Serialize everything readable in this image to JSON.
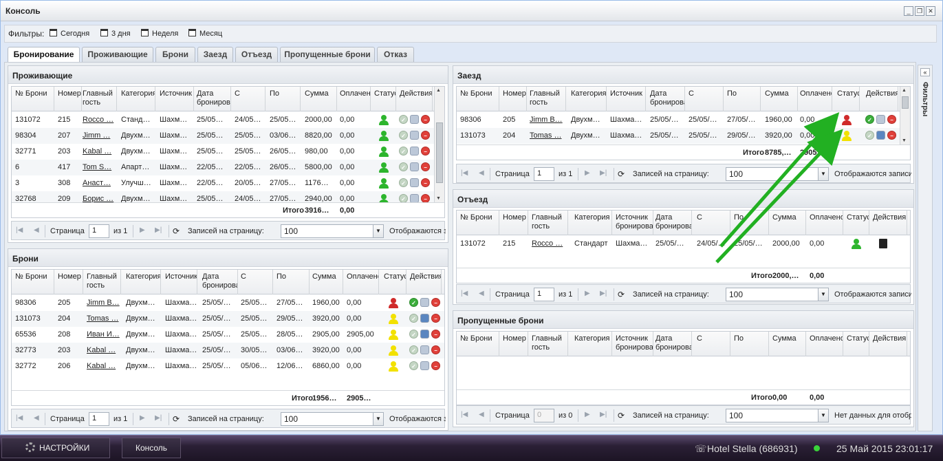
{
  "window": {
    "title": "Консоль"
  },
  "filters": {
    "label": "Фильтры:",
    "buttons": [
      "Сегодня",
      "3 дня",
      "Неделя",
      "Месяц"
    ]
  },
  "tabs": [
    "Бронирование",
    "Проживающие",
    "Брони",
    "Заезд",
    "Отъезд",
    "Пропущенные брони",
    "Отказ"
  ],
  "sidebar": {
    "label": "Фильтры"
  },
  "pager": {
    "page": "Страница",
    "of": "из 1",
    "of0": "из 0",
    "per_page": "Записей на страницу:",
    "per_page_value": "100",
    "shown": "Отображаются записи",
    "no_data": "Нет данных для отображения",
    "page_num": "1",
    "page_num_empty": "0"
  },
  "panels": {
    "residents": {
      "title": "Проживающие",
      "columns": [
        "№ Брони",
        "Номер",
        "Главный гость",
        "Категория",
        "Источник",
        "Дата бронирования",
        "С",
        "По",
        "Сумма",
        "Оплачено",
        "Статус",
        "Действия"
      ],
      "rows": [
        [
          "131072",
          "215",
          "Rocco …",
          "Станд…",
          "Шахм…",
          "25/05…",
          "24/05…",
          "25/05…",
          "2000,00",
          "0,00"
        ],
        [
          "98304",
          "207",
          "Jimm …",
          "Двухм…",
          "Шахм…",
          "25/05…",
          "25/05…",
          "03/06…",
          "8820,00",
          "0,00"
        ],
        [
          "32771",
          "203",
          "Kabal …",
          "Двухм…",
          "Шахм…",
          "25/05…",
          "25/05…",
          "26/05…",
          "980,00",
          "0,00"
        ],
        [
          "6",
          "417",
          "Tom S…",
          "Апарт…",
          "Шахм…",
          "22/05…",
          "22/05…",
          "26/05…",
          "5800,00",
          "0,00"
        ],
        [
          "3",
          "308",
          "Анаст…",
          "Улучш…",
          "Шахм…",
          "22/05…",
          "20/05…",
          "27/05…",
          "1176…",
          "0,00"
        ],
        [
          "32768",
          "209",
          "Борис …",
          "Двухм…",
          "Шахм…",
          "25/05…",
          "24/05…",
          "27/05…",
          "2940,00",
          "0,00"
        ]
      ],
      "status": [
        "green",
        "green",
        "green",
        "green",
        "green",
        "green"
      ],
      "total_label": "Итого",
      "total_sum": "3916…",
      "total_paid": "0,00"
    },
    "bookings": {
      "title": "Брони",
      "columns": [
        "№ Брони",
        "Номер",
        "Главный гость",
        "Категория",
        "Источник",
        "Дата бронирования",
        "С",
        "По",
        "Сумма",
        "Оплачено",
        "Статус",
        "Действия"
      ],
      "rows": [
        [
          "98306",
          "205",
          "Jimm B…",
          "Двухм…",
          "Шахма…",
          "25/05/…",
          "25/05…",
          "27/05…",
          "1960,00",
          "0,00"
        ],
        [
          "131073",
          "204",
          "Tomas …",
          "Двухм…",
          "Шахма…",
          "25/05/…",
          "25/05…",
          "29/05…",
          "3920,00",
          "0,00"
        ],
        [
          "65536",
          "208",
          "Иван И…",
          "Двухм…",
          "Шахма…",
          "25/05/…",
          "25/05…",
          "28/05…",
          "2905,00",
          "2905,00"
        ],
        [
          "32773",
          "203",
          "Kabal …",
          "Двухм…",
          "Шахма…",
          "25/05/…",
          "30/05…",
          "03/06…",
          "3920,00",
          "0,00"
        ],
        [
          "32772",
          "206",
          "Kabal …",
          "Двухм…",
          "Шахма…",
          "25/05/…",
          "05/06…",
          "12/06…",
          "6860,00",
          "0,00"
        ]
      ],
      "status": [
        "red",
        "yellow",
        "yellow",
        "yellow",
        "yellow"
      ],
      "total_label": "Итого",
      "total_sum": "1956…",
      "total_paid": "2905…"
    },
    "checkin": {
      "title": "Заезд",
      "columns": [
        "№ Брони",
        "Номер",
        "Главный гость",
        "Категория",
        "Источник",
        "Дата бронирования",
        "С",
        "По",
        "Сумма",
        "Оплачено",
        "Статус",
        "Действия"
      ],
      "rows": [
        [
          "98306",
          "205",
          "Jimm B…",
          "Двухм…",
          "Шахма…",
          "25/05/…",
          "25/05/…",
          "27/05/…",
          "1960,00",
          "0,00"
        ],
        [
          "131073",
          "204",
          "Tomas …",
          "Двухм…",
          "Шахма…",
          "25/05/…",
          "25/05/…",
          "29/05/…",
          "3920,00",
          "0,00"
        ]
      ],
      "status": [
        "red",
        "yellow"
      ],
      "total_label": "Итого",
      "total_sum": "8785,…",
      "total_paid": "2905…"
    },
    "checkout": {
      "title": "Отъезд",
      "columns": [
        "№ Брони",
        "Номер",
        "Главный гость",
        "Категория",
        "Источник бронирования",
        "Дата бронирования",
        "С",
        "По",
        "Сумма",
        "Оплачено",
        "Статус",
        "Действия"
      ],
      "rows": [
        [
          "131072",
          "215",
          "Rocco …",
          "Стандарт",
          "Шахма…",
          "25/05/…",
          "24/05/…",
          "25/05/…",
          "2000,00",
          "0,00"
        ]
      ],
      "status": [
        "green"
      ],
      "total_label": "Итого",
      "total_sum": "2000,…",
      "total_paid": "0,00"
    },
    "missed": {
      "title": "Пропущенные брони",
      "columns": [
        "№ Брони",
        "Номер",
        "Главный гость",
        "Категория",
        "Источник бронирования",
        "Дата бронирования",
        "С",
        "По",
        "Сумма",
        "Оплачено",
        "Статус",
        "Действия"
      ],
      "rows": [],
      "total_label": "Итого",
      "total_sum": "0,00",
      "total_paid": "0,00"
    }
  },
  "taskbar": {
    "settings": "НАСТРОЙКИ",
    "console": "Консоль",
    "hotel": "Hotel Stella (686931)",
    "datetime": "25 Май 2015 23:01:17"
  },
  "colors": {
    "status_green": "#2db52d",
    "status_red": "#d02b2b",
    "status_yellow": "#f2e100",
    "annotation_arrow": "#22b022"
  }
}
